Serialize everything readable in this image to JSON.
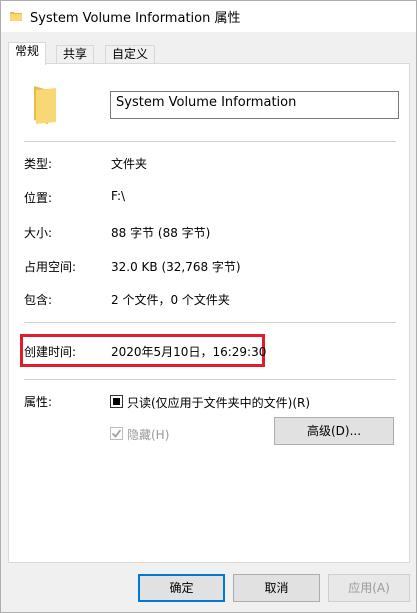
{
  "window": {
    "title": "System Volume Information 属性"
  },
  "tabs": [
    {
      "label": "常规",
      "active": true
    },
    {
      "label": "共享",
      "active": false
    },
    {
      "label": "自定义",
      "active": false
    }
  ],
  "general": {
    "name_value": "System Volume Information",
    "rows": [
      {
        "label": "类型:",
        "value": "文件夹"
      },
      {
        "label": "位置:",
        "value": "F:\\"
      },
      {
        "label": "大小:",
        "value": "88 字节 (88 字节)"
      },
      {
        "label": "占用空间:",
        "value": "32.0 KB (32,768 字节)"
      },
      {
        "label": "包含:",
        "value": "2 个文件，0 个文件夹"
      },
      {
        "label": "创建时间:",
        "value": "2020年5月10日，16:29:30"
      }
    ],
    "attributes_label": "属性:",
    "readonly_label": "只读(仅应用于文件夹中的文件)(R)",
    "readonly_state": "indeterminate",
    "hidden_label": "隐藏(H)",
    "hidden_checked": true,
    "advanced_button": "高级(D)...",
    "highlight_color": "#e01e2b"
  },
  "footer": {
    "ok": "确定",
    "cancel": "取消",
    "apply": "应用(A)"
  },
  "colors": {
    "folder": "#f8d775",
    "folder_dark": "#e9b949",
    "accent": "#0078d7"
  }
}
